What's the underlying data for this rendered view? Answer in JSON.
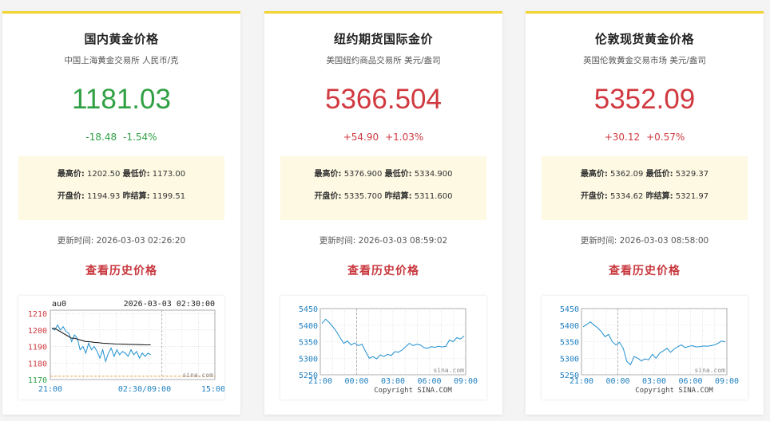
{
  "cards": [
    {
      "title": "国内黄金价格",
      "subtitle": "中国上海黄金交易所 人民币/克",
      "price": "1181.03",
      "change": "-18.48",
      "change_pct": "-1.54%",
      "direction": "down",
      "high_label": "最高价:",
      "high": "1202.50",
      "low_label": "最低价:",
      "low": "1173.00",
      "open_label": "开盘价:",
      "open": "1194.93",
      "settle_label": "昨结算:",
      "settle": "1199.51",
      "updated_label": "更新时间:",
      "updated": "2026-03-03 02:26:20",
      "history_link": "查看历史价格"
    },
    {
      "title": "纽约期货国际金价",
      "subtitle": "美国纽约商品交易所 美元/盎司",
      "price": "5366.504",
      "change": "+54.90",
      "change_pct": "+1.03%",
      "direction": "up",
      "high_label": "最高价:",
      "high": "5376.900",
      "low_label": "最低价:",
      "low": "5334.900",
      "open_label": "开盘价:",
      "open": "5335.700",
      "settle_label": "昨结算:",
      "settle": "5311.600",
      "updated_label": "更新时间:",
      "updated": "2026-03-03 08:59:02",
      "history_link": "查看历史价格"
    },
    {
      "title": "伦敦现货黄金价格",
      "subtitle": "英国伦敦黄金交易市场 美元/盎司",
      "price": "5352.09",
      "change": "+30.12",
      "change_pct": "+0.57%",
      "direction": "up",
      "high_label": "最高价:",
      "high": "5362.09",
      "low_label": "最低价:",
      "low": "5329.37",
      "open_label": "开盘价:",
      "open": "5334.62",
      "settle_label": "昨结算:",
      "settle": "5321.97",
      "updated_label": "更新时间:",
      "updated": "2026-03-03 08:58:00",
      "history_link": "查看历史价格"
    }
  ],
  "colors": {
    "up": "#d0393f",
    "down": "#2fa043",
    "accent": "#f2d22e",
    "line": "#1e8fd0",
    "avg": "#222222"
  },
  "chart_data": [
    {
      "type": "line",
      "title": "au0",
      "timestamp": "2026-03-03 02:30:00",
      "watermark": "sina.com",
      "x_tick_labels": [
        "21:00",
        "02:30/09:00",
        "15:00"
      ],
      "y_ticks": [
        1170,
        1180,
        1190,
        1200,
        1210
      ],
      "ylim": [
        1170,
        1212
      ],
      "session_fraction": 0.62,
      "series": [
        {
          "values": [
            1201,
            1200,
            1203,
            1200,
            1202,
            1199,
            1198,
            1193,
            1197,
            1195,
            1188,
            1190,
            1186,
            1192,
            1188,
            1190,
            1187,
            1183,
            1188,
            1181,
            1186,
            1189,
            1184,
            1188,
            1185,
            1187,
            1186,
            1184,
            1188,
            1185,
            1187,
            1183,
            1186,
            1184,
            1186,
            1185
          ]
        },
        {
          "values": [
            1201,
            1201,
            1200,
            1199,
            1198,
            1197,
            1196,
            1195,
            1195,
            1194.5,
            1194,
            1193.5,
            1193,
            1193,
            1192.8,
            1192.5,
            1192.4,
            1192.2,
            1192,
            1191.9,
            1191.8,
            1191.7,
            1191.6,
            1191.5,
            1191.5,
            1191.4,
            1191.4,
            1191.3,
            1191.3,
            1191.2,
            1191.2,
            1191.1,
            1191.1,
            1191,
            1191,
            1191
          ]
        }
      ],
      "baseline": 1172
    },
    {
      "type": "line",
      "watermark": "sina.com",
      "copyright": "Copyright  SINA.COM",
      "x_tick_labels": [
        "21:00",
        "00:00",
        "03:00",
        "06:00",
        "09:00"
      ],
      "y_ticks": [
        5250,
        5300,
        5350,
        5400,
        5450
      ],
      "ylim": [
        5250,
        5450
      ],
      "series": [
        {
          "values": [
            5405,
            5418,
            5408,
            5395,
            5380,
            5362,
            5345,
            5352,
            5340,
            5346,
            5338,
            5342,
            5320,
            5300,
            5305,
            5298,
            5310,
            5305,
            5312,
            5308,
            5320,
            5318,
            5325,
            5335,
            5345,
            5338,
            5342,
            5340,
            5332,
            5330,
            5335,
            5333,
            5336,
            5334,
            5336,
            5355,
            5350,
            5362,
            5358,
            5367
          ]
        }
      ]
    },
    {
      "type": "line",
      "watermark": "sina.com",
      "copyright": "Copyright  SINA.COM",
      "x_tick_labels": [
        "21:00",
        "00:00",
        "03:00",
        "06:00",
        "09:00"
      ],
      "y_ticks": [
        5250,
        5300,
        5350,
        5400,
        5450
      ],
      "ylim": [
        5250,
        5450
      ],
      "series": [
        {
          "values": [
            5395,
            5402,
            5410,
            5400,
            5392,
            5380,
            5365,
            5372,
            5350,
            5340,
            5348,
            5330,
            5290,
            5280,
            5305,
            5300,
            5292,
            5298,
            5295,
            5312,
            5300,
            5315,
            5322,
            5330,
            5318,
            5328,
            5335,
            5340,
            5332,
            5336,
            5338,
            5334,
            5335,
            5337,
            5336,
            5338,
            5340,
            5345,
            5352,
            5349
          ]
        }
      ]
    }
  ]
}
